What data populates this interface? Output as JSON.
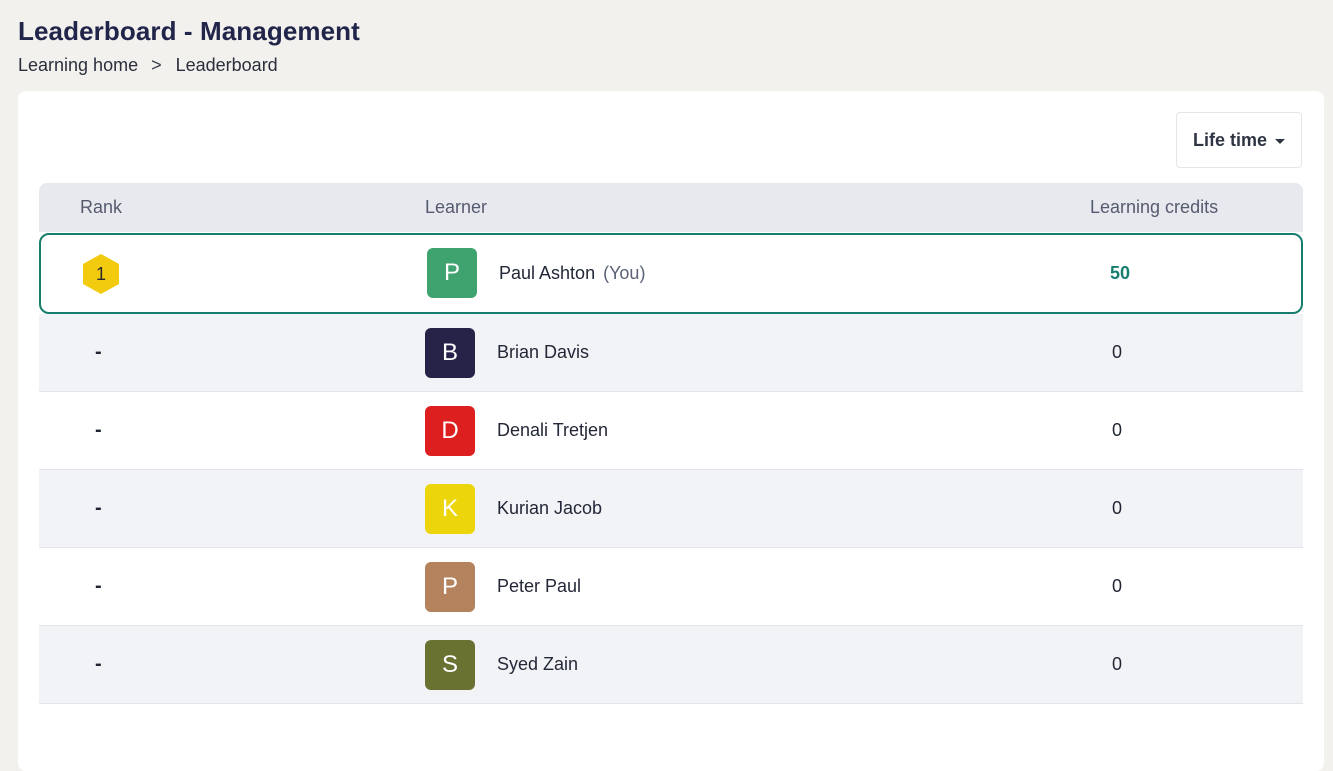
{
  "header": {
    "title": "Leaderboard - Management",
    "breadcrumb": {
      "home": "Learning home",
      "separator": ">",
      "current": "Leaderboard"
    }
  },
  "filter": {
    "label": "Life time",
    "icon": "caret-down-icon"
  },
  "table": {
    "columns": {
      "rank": "Rank",
      "learner": "Learner",
      "credits": "Learning credits"
    },
    "current_user": {
      "rank": "1",
      "initial": "P",
      "name": "Paul Ashton",
      "you_label": "(You)",
      "credits": "50",
      "avatar_color": "#3ea36f",
      "badge_color": "#f2cb0f",
      "highlight_color": "#177e6e"
    },
    "rows": [
      {
        "rank": "-",
        "initial": "B",
        "name": "Brian Davis",
        "credits": "0",
        "avatar_color": "#262248"
      },
      {
        "rank": "-",
        "initial": "D",
        "name": "Denali Tretjen",
        "credits": "0",
        "avatar_color": "#de1f1f"
      },
      {
        "rank": "-",
        "initial": "K",
        "name": "Kurian Jacob",
        "credits": "0",
        "avatar_color": "#ecd50b"
      },
      {
        "rank": "-",
        "initial": "P",
        "name": "Peter Paul",
        "credits": "0",
        "avatar_color": "#b4835e"
      },
      {
        "rank": "-",
        "initial": "S",
        "name": "Syed Zain",
        "credits": "0",
        "avatar_color": "#6a7232"
      }
    ]
  }
}
